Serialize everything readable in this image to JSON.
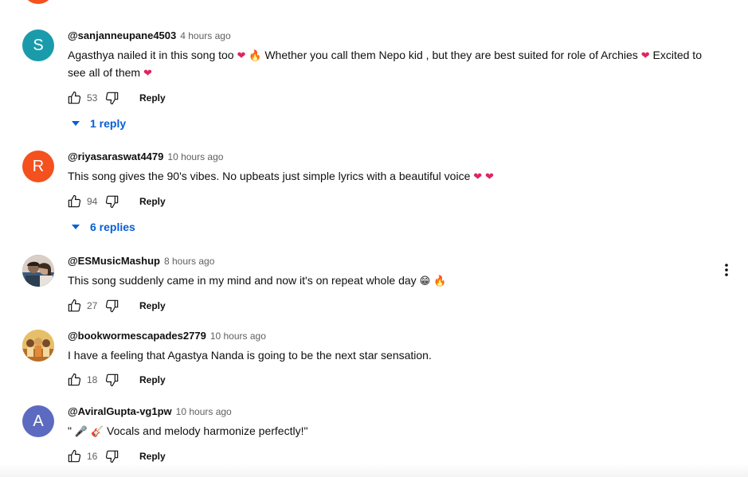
{
  "ui": {
    "reply_label": "Reply",
    "icons": [
      "thumb-up-icon",
      "thumb-down-icon",
      "caret-down-icon",
      "more-vert-icon"
    ],
    "colors": {
      "link": "#065fd4",
      "muted": "#606060",
      "text": "#0f0f0f"
    }
  },
  "comments": [
    {
      "author": "@sanjanneupane4503",
      "time": "4 hours ago",
      "avatar": {
        "letter": "S",
        "color": "#1a9bab"
      },
      "text_parts": [
        "Agasthya nailed it in this song too ",
        "❤",
        " ",
        "🔥",
        " Whether you call them Nepo kid , but they are best suited for role of Archies ",
        "❤",
        " Excited to see all of them ",
        "❤"
      ],
      "likes": "53",
      "replies": "1 reply"
    },
    {
      "author": "@riyasaraswat4479",
      "time": "10 hours ago",
      "avatar": {
        "letter": "R",
        "color": "#f4511e"
      },
      "text_parts": [
        "This song gives the 90's vibes. No upbeats just simple lyrics with a beautiful voice ",
        "❤",
        " ",
        "❤"
      ],
      "likes": "94",
      "replies": "6 replies"
    },
    {
      "author": "@ESMusicMashup",
      "time": "8 hours ago",
      "avatar": {
        "letter": "",
        "color": "#6b5a4e"
      },
      "text_parts": [
        "This song suddenly came in my mind and now it's on repeat whole day ",
        "😁",
        " ",
        "🔥"
      ],
      "likes": "27"
    },
    {
      "author": "@bookwormescapades2779",
      "time": "10 hours ago",
      "avatar": {
        "letter": "",
        "color": "#c99a3a"
      },
      "text_parts": [
        "I have a feeling that Agastya Nanda is going to be the next star sensation."
      ],
      "likes": "18"
    },
    {
      "author": "@AviralGupta-vg1pw",
      "time": "10 hours ago",
      "avatar": {
        "letter": "A",
        "color": "#5c6bc0"
      },
      "text_parts": [
        "\" ",
        "🎤",
        " ",
        "🎸",
        " Vocals and melody harmonize perfectly!\""
      ],
      "likes": "16"
    }
  ]
}
